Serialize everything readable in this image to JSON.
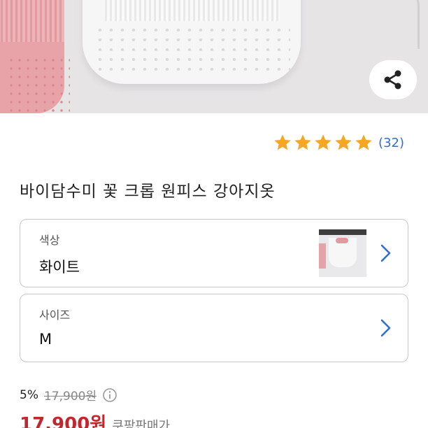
{
  "hero": {
    "share_icon": "share-icon",
    "colors": {
      "pink": "#e8a3a8",
      "white": "#f6f6f6"
    }
  },
  "rating": {
    "stars": 5,
    "star_color": "#f5a623",
    "count": "(32)"
  },
  "product": {
    "title": "바이담수미 꽃 크롭 원피스 강아지옷"
  },
  "options": {
    "color": {
      "label": "색상",
      "value": "화이트",
      "chevron_icon": "chevron-right-icon"
    },
    "size": {
      "label": "사이즈",
      "value": "M",
      "chevron_icon": "chevron-right-icon"
    }
  },
  "price": {
    "discount": "5%",
    "original": "17,900원",
    "info_icon": "info-icon",
    "current": "17,900원",
    "note": "쿠팡판매가",
    "accent": "#c0282e"
  }
}
